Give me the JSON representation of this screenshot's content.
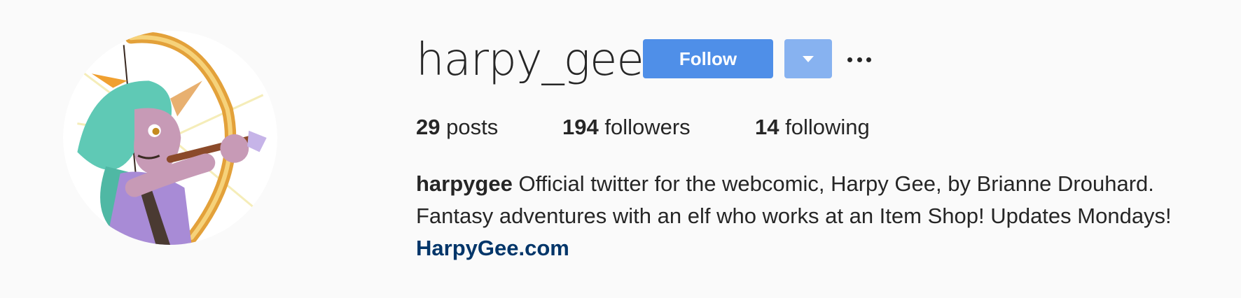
{
  "profile": {
    "username": "harpy_gee",
    "follow_label": "Follow",
    "avatar_icon": "profile-avatar-illustration"
  },
  "stats": {
    "posts_count": "29",
    "posts_label": "posts",
    "followers_count": "194",
    "followers_label": "followers",
    "following_count": "14",
    "following_label": "following"
  },
  "bio": {
    "full_name": "harpygee",
    "line1": "Official twitter for the webcomic, Harpy Gee, by Brianne Drouhard.",
    "line2": "Fantasy adventures with an elf who works at an Item Shop! Updates Mondays!",
    "link": "HarpyGee.com"
  },
  "colors": {
    "follow_button": "#4f8fe8",
    "dropdown_button": "#87b2f0",
    "link": "#003569",
    "background": "#fafafa"
  }
}
